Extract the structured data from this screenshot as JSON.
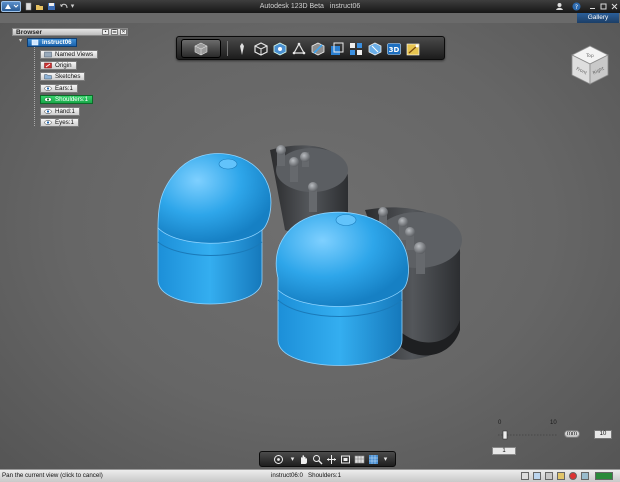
{
  "window": {
    "app_name": "Autodesk 123D Beta",
    "document_name": "instruct06"
  },
  "title_bar": {
    "gallery_label": "Gallery",
    "quick_access_icons": [
      "new-icon",
      "open-icon",
      "save-icon",
      "undo-icon",
      "redo-icon"
    ]
  },
  "browser": {
    "title": "Browser",
    "root_label": "instruct06",
    "items": [
      {
        "label": "Named Views",
        "icon": "views-icon"
      },
      {
        "label": "Origin",
        "icon": "origin-icon"
      },
      {
        "label": "Sketches",
        "icon": "folder-icon"
      },
      {
        "label": "Ears:1",
        "icon": "eye-icon"
      },
      {
        "label": "Shoulders:1",
        "icon": "eye-icon",
        "active": true
      },
      {
        "label": "Hand:1",
        "icon": "eye-icon"
      },
      {
        "label": "Eyes:1",
        "icon": "eye-icon"
      }
    ]
  },
  "toolbar": {
    "tools": [
      "primitives-icon",
      "sketch-icon",
      "construct-icon",
      "modify-icon",
      "pattern-icon",
      "grouping-icon",
      "combine-icon",
      "measure-icon",
      "text-3d-icon",
      "material-icon"
    ]
  },
  "viewcube": {
    "faces": {
      "top": "Top",
      "front": "Front",
      "right": "Right"
    }
  },
  "scale": {
    "tick_start": "0",
    "tick_end": "10",
    "unit": "mm",
    "value": "10",
    "sub_value": "1"
  },
  "navbar": {
    "tools": [
      "orbit-icon",
      "pan-icon",
      "zoom-icon",
      "fit-icon",
      "look-at-icon",
      "view-style-icon",
      "grid-icon",
      "settings-icon"
    ]
  },
  "status": {
    "hint": "Pan the current view (click to cancel)",
    "tabs": [
      "instruct06:0",
      "Shoulders:1"
    ]
  },
  "colors": {
    "selection_blue": "#2aa4e8",
    "body_dark": "#3b3d40",
    "viewport_bg": "#6a6a6a",
    "root_highlight": "#1b63ad",
    "active_highlight": "#1aa84a"
  }
}
